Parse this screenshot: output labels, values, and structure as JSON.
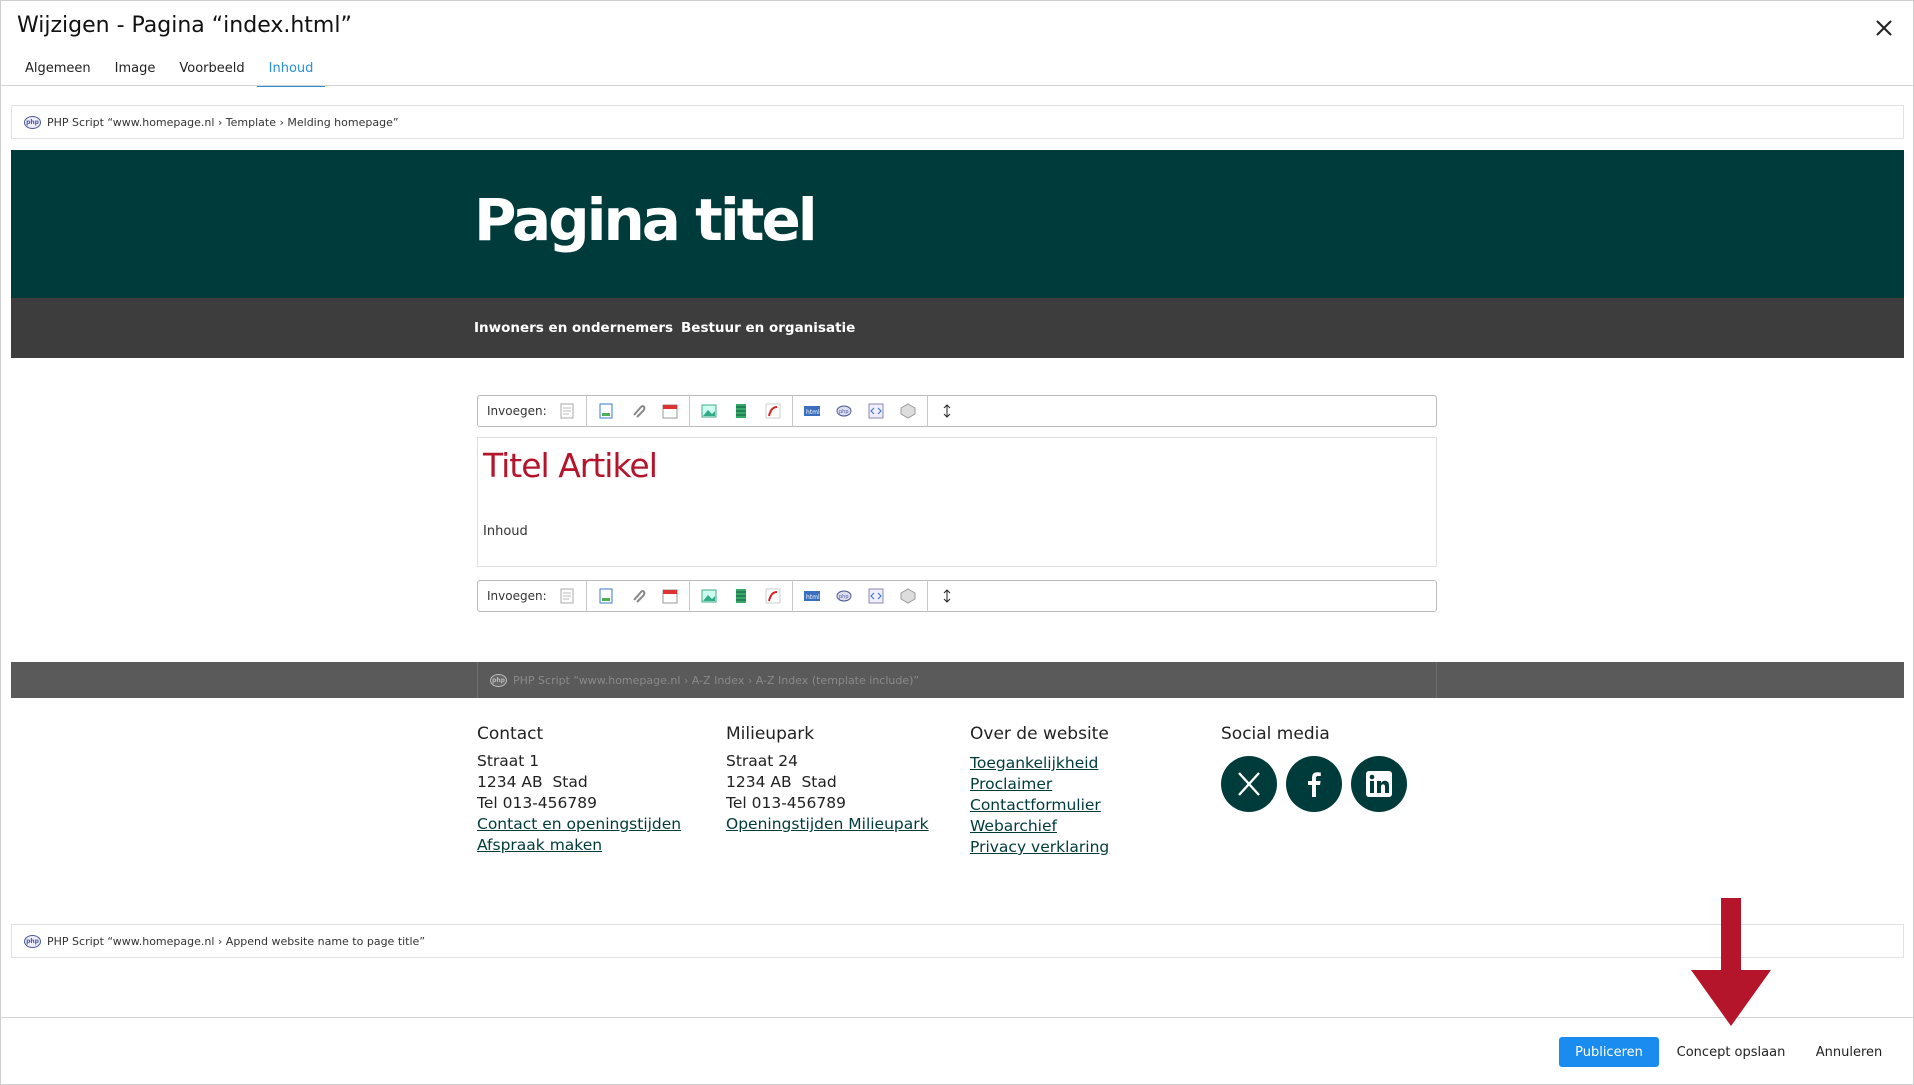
{
  "dialog": {
    "title": "Wijzigen - Pagina “index.html”",
    "tabs": [
      {
        "label": "Algemeen"
      },
      {
        "label": "Image"
      },
      {
        "label": "Voorbeeld"
      },
      {
        "label": "Inhoud",
        "active": true
      }
    ]
  },
  "php_bars": {
    "top": "PHP Script “www.homepage.nl › Template › Melding homepage”",
    "footer": "PHP Script “www.homepage.nl › A-Z Index › A-Z Index (template include)”",
    "bottom": "PHP Script “www.homepage.nl › Append website name to page title”"
  },
  "site": {
    "title": "Pagina titel",
    "nav": [
      "Inwoners en ondernemers",
      "Bestuur en organisatie"
    ],
    "colors": {
      "header": "#003b3b",
      "nav": "#3d3d3d",
      "article_title": "#b5152b"
    }
  },
  "toolbar": {
    "label": "Invoegen:",
    "icons": [
      "page-icon",
      "document-icon",
      "attachment-icon",
      "calendar-icon",
      "image-icon",
      "film-icon",
      "flash-icon",
      "html-icon",
      "php-icon",
      "code-icon",
      "module-icon",
      "resize-icon"
    ]
  },
  "article": {
    "title": "Titel Artikel",
    "body": "Inhoud"
  },
  "footer": {
    "contact": {
      "heading": "Contact",
      "lines": [
        "Straat 1",
        "1234 AB  Stad",
        "Tel 013-456789"
      ],
      "links": [
        "Contact en openingstijden",
        "Afspraak maken"
      ]
    },
    "milieupark": {
      "heading": "Milieupark",
      "lines": [
        "Straat 24",
        "1234 AB  Stad",
        "Tel 013-456789"
      ],
      "links": [
        "Openingstijden Milieupark"
      ]
    },
    "website": {
      "heading": "Over de website",
      "links": [
        "Toegankelijkheid",
        "Proclaimer",
        "Contactformulier",
        "Webarchief",
        "Privacy verklaring"
      ]
    },
    "social": {
      "heading": "Social media",
      "icons": [
        "x-icon",
        "facebook-icon",
        "linkedin-icon"
      ]
    }
  },
  "actions": {
    "publish": "Publiceren",
    "save_draft": "Concept opslaan",
    "cancel": "Annuleren",
    "primary_color": "#1a8cf0",
    "arrow_color": "#b5152b"
  }
}
